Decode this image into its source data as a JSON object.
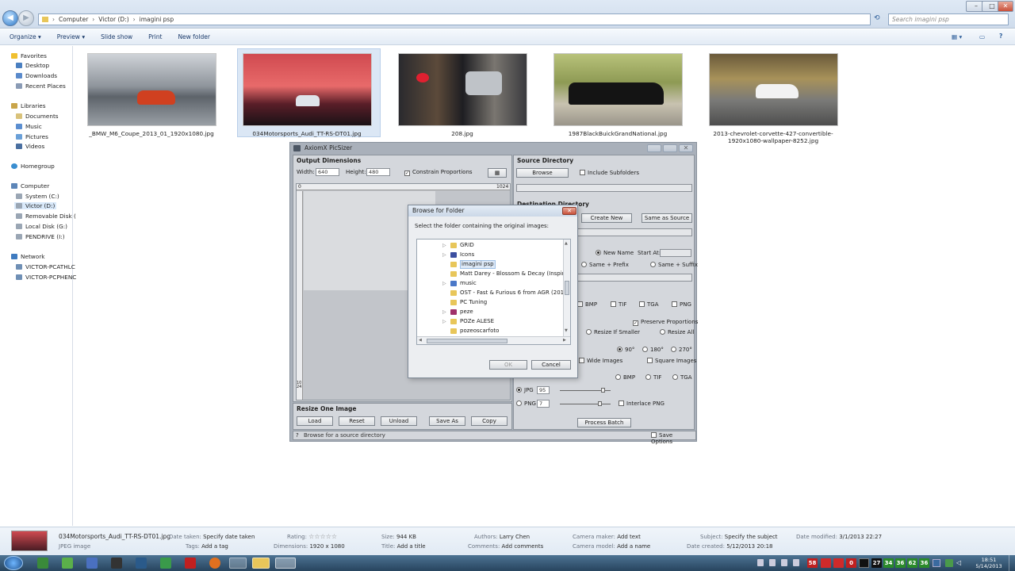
{
  "explorer": {
    "breadcrumb": [
      "Computer",
      "Victor (D:)",
      "imagini psp"
    ],
    "search_placeholder": "Search imagini psp",
    "toolbar": [
      "Organize ▾",
      "Preview ▾",
      "Slide show",
      "Print",
      "New folder"
    ],
    "nav": {
      "favorites": "Favorites",
      "favorites_items": [
        "Desktop",
        "Downloads",
        "Recent Places"
      ],
      "libraries": "Libraries",
      "libraries_items": [
        "Documents",
        "Music",
        "Pictures",
        "Videos"
      ],
      "homegroup": "Homegroup",
      "computer": "Computer",
      "computer_items": [
        "System (C:)",
        "Victor (D:)",
        "Removable Disk (",
        "Local Disk (G:)",
        "PENDRIVE (I:)"
      ],
      "network": "Network",
      "network_items": [
        "VICTOR-PCATHLC",
        "VICTOR-PCPHENC"
      ]
    },
    "files": [
      {
        "name": "_BMW_M6_Coupe_2013_01_1920x1080.jpg",
        "selected": false
      },
      {
        "name": "034Motorsports_Audi_TT-RS-DT01.jpg",
        "selected": true
      },
      {
        "name": "208.jpg",
        "selected": false
      },
      {
        "name": "1987BlackBuickGrandNational.jpg",
        "selected": false
      },
      {
        "name": "2013-chevrolet-corvette-427-convertible-1920x1080-wallpaper-8252.jpg",
        "selected": false
      }
    ]
  },
  "details": {
    "filename": "034Motorsports_Audi_TT-RS-DT01.jpg",
    "filetype": "JPEG image",
    "date_taken_label": "Date taken:",
    "date_taken": "Specify date taken",
    "tags_label": "Tags:",
    "tags": "Add a tag",
    "rating_label": "Rating:",
    "rating": "☆☆☆☆☆",
    "dimensions_label": "Dimensions:",
    "dimensions": "1920 x 1080",
    "size_label": "Size:",
    "size": "944 KB",
    "title_label": "Title:",
    "title": "Add a title",
    "authors_label": "Authors:",
    "authors": "Larry Chen",
    "comments_label": "Comments:",
    "comments": "Add comments",
    "camera_maker_label": "Camera maker:",
    "camera_maker": "Add text",
    "camera_model_label": "Camera model:",
    "camera_model": "Add a name",
    "subject_label": "Subject:",
    "subject": "Specify the subject",
    "date_created_label": "Date created:",
    "date_created": "5/12/2013 20:18",
    "date_modified_label": "Date modified:",
    "date_modified": "3/1/2013 22:27"
  },
  "picsizer": {
    "title": "AxiomX PicSizer",
    "output": {
      "title": "Output Dimensions",
      "width_label": "Width:",
      "width": "640",
      "height_label": "Height:",
      "height": "480",
      "constrain": "Constrain Proportions",
      "ruler_start": "0",
      "ruler_end": "1024",
      "ruler_vertical": "1024"
    },
    "source": {
      "title": "Source Directory",
      "browse": "Browse",
      "include_subfolders": "Include Subfolders"
    },
    "destination": {
      "title": "Destination Directory",
      "create_new": "Create New",
      "same_as_source": "Same as Source"
    },
    "naming": {
      "new_name": "New Name",
      "start_at": "Start At:",
      "same_prefix": "Same + Prefix",
      "same_suffix": "Same + Suffix"
    },
    "formats_top": [
      "BMP",
      "TIF",
      "TGA",
      "PNG"
    ],
    "preserve": "Preserve Proportions",
    "resize_smaller": "Resize If Smaller",
    "resize_all": "Resize All",
    "rotate": [
      "90°",
      "180°",
      "270°"
    ],
    "wide_images": "Wide Images",
    "square_images": "Square Images",
    "output_formats": [
      "BMP",
      "TIF",
      "TGA"
    ],
    "jpg_label": "JPG",
    "jpg_quality": "95",
    "png_label": "PNG",
    "png_level": "7",
    "interlace_png": "Interlace PNG",
    "process_batch": "Process Batch",
    "resize_one": {
      "title": "Resize One Image",
      "buttons": [
        "Load",
        "Reset",
        "Unload",
        "Save As",
        "Copy"
      ]
    },
    "status_help": "?",
    "status": "Browse for a source directory",
    "save_options": "Save Options"
  },
  "dialog": {
    "title": "Browse for Folder",
    "prompt": "Select the folder containing the original images:",
    "tree": [
      "GRID",
      "Icons",
      "imagini psp",
      "Matt Darey - Blossom & Decay (Inspiron",
      "music",
      "OST - Fast & Furious 6 from AGR (2013)",
      "PC Tuning",
      "peze",
      "POZe ALESE",
      "pozeoscarfoto"
    ],
    "selected_index": 2,
    "ok": "OK",
    "cancel": "Cancel"
  },
  "taskbar": {
    "tray_numbers": [
      "58",
      "0",
      "27",
      "34",
      "36",
      "62",
      "36"
    ],
    "time": "18:51",
    "date": "5/14/2013"
  },
  "colors": {
    "accent": "#3a78c4",
    "window_bg": "#a9b0ba",
    "panel_bg": "#d4d7dc"
  }
}
